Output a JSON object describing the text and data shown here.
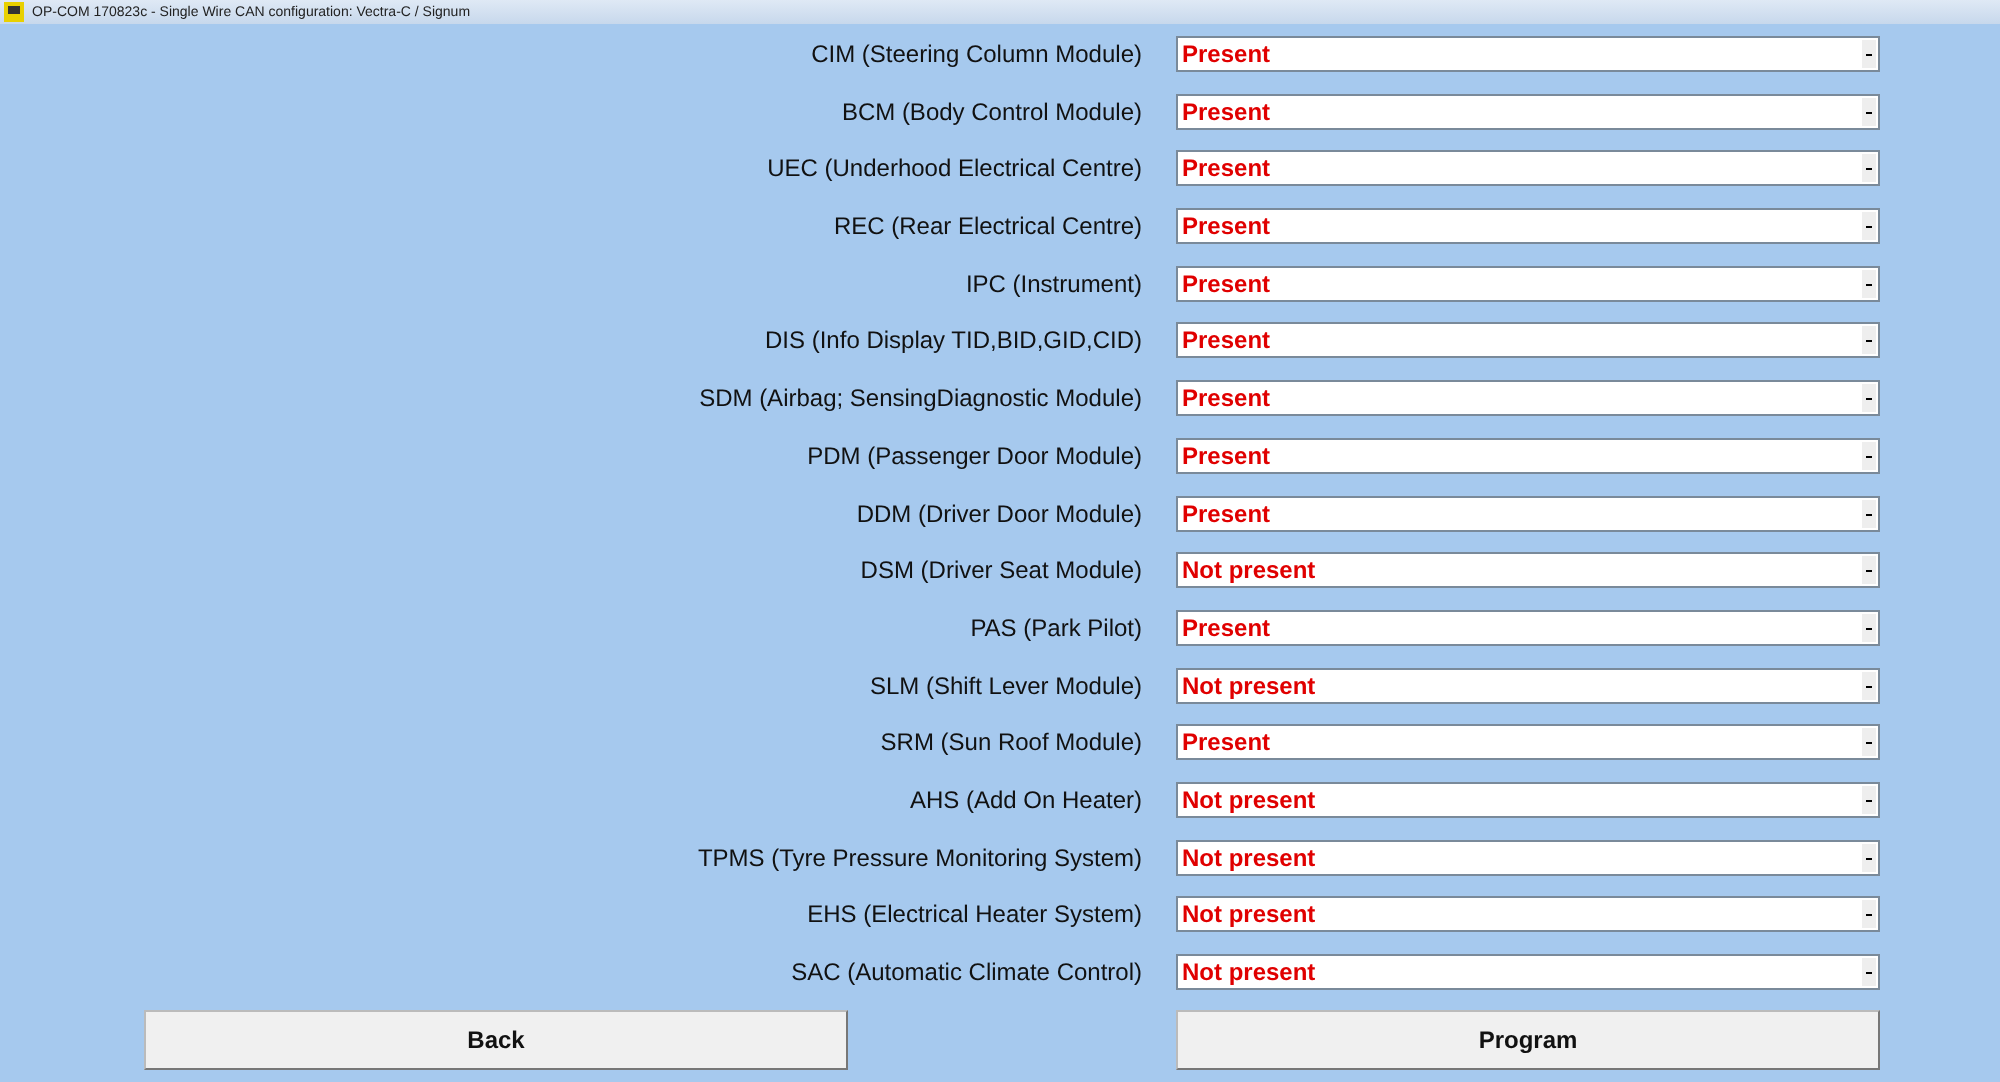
{
  "window": {
    "title": "OP-COM 170823c - Single Wire CAN configuration: Vectra-C / Signum"
  },
  "modules": [
    {
      "label": "CIM (Steering Column Module)",
      "value": "Present"
    },
    {
      "label": "BCM (Body Control Module)",
      "value": "Present"
    },
    {
      "label": "UEC (Underhood Electrical Centre)",
      "value": "Present"
    },
    {
      "label": "REC (Rear Electrical Centre)",
      "value": "Present"
    },
    {
      "label": "IPC (Instrument)",
      "value": "Present"
    },
    {
      "label": "DIS (Info Display TID,BID,GID,CID)",
      "value": "Present"
    },
    {
      "label": "SDM (Airbag; SensingDiagnostic Module)",
      "value": "Present"
    },
    {
      "label": "PDM (Passenger Door Module)",
      "value": "Present"
    },
    {
      "label": "DDM (Driver Door Module)",
      "value": "Present"
    },
    {
      "label": "DSM (Driver Seat Module)",
      "value": "Not present"
    },
    {
      "label": "PAS (Park Pilot)",
      "value": "Present"
    },
    {
      "label": "SLM (Shift Lever Module)",
      "value": "Not present"
    },
    {
      "label": "SRM (Sun Roof Module)",
      "value": "Present"
    },
    {
      "label": "AHS (Add On Heater)",
      "value": "Not present"
    },
    {
      "label": "TPMS (Tyre Pressure Monitoring System)",
      "value": "Not present"
    },
    {
      "label": "EHS (Electrical Heater System)",
      "value": "Not present"
    },
    {
      "label": "SAC (Automatic Climate Control)",
      "value": "Not present"
    }
  ],
  "buttons": [
    "Back",
    "Program"
  ]
}
